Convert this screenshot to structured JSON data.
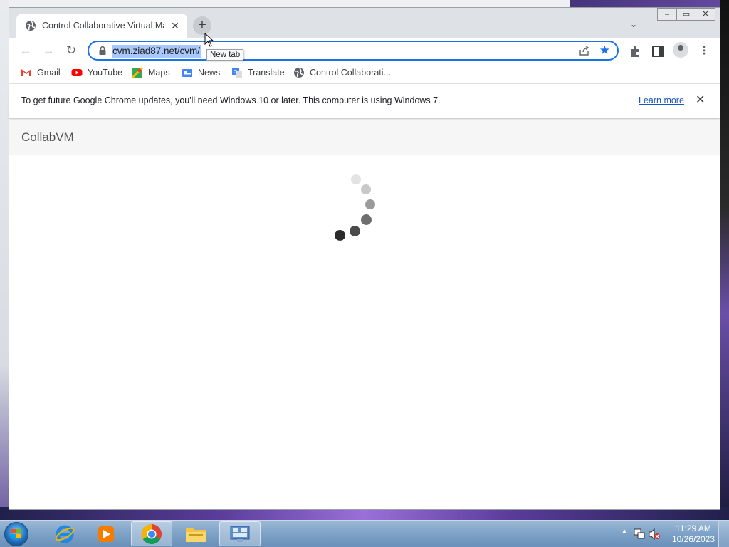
{
  "browser": {
    "tab": {
      "title": "Control Collaborative Virtual Machine",
      "close_glyph": "✕"
    },
    "new_tab_glyph": "+",
    "tab_search_glyph": "⌄",
    "window_controls": {
      "minimize": "–",
      "maximize": "▭",
      "close": "✕"
    },
    "tooltip": "New tab",
    "nav": {
      "back": "←",
      "forward": "→",
      "reload": "↻"
    },
    "omnibox": {
      "url": "cvm.ziad87.net/cvm/"
    },
    "bookmarks": [
      {
        "label": "Gmail",
        "icon": "gmail-icon"
      },
      {
        "label": "YouTube",
        "icon": "youtube-icon"
      },
      {
        "label": "Maps",
        "icon": "maps-icon"
      },
      {
        "label": "News",
        "icon": "news-icon"
      },
      {
        "label": "Translate",
        "icon": "translate-icon"
      },
      {
        "label": "Control Collaborati...",
        "icon": "globe-icon"
      }
    ],
    "infobar": {
      "message": "To get future Google Chrome updates, you'll need Windows 10 or later. This computer is using Windows 7.",
      "link": "Learn more",
      "close_glyph": "✕"
    }
  },
  "page": {
    "brand": "CollabVM",
    "state": "loading"
  },
  "taskbar": {
    "apps": [
      "internet-explorer-icon",
      "media-player-icon",
      "chrome-icon",
      "file-explorer-icon",
      "control-panel-icon"
    ],
    "active_app": "chrome-icon",
    "clock": {
      "time": "11:29 AM",
      "date": "10/26/2023"
    }
  },
  "colors": {
    "accent": "#1a73e8",
    "taskbar": "#7fa3c8",
    "link": "#1a57c5"
  }
}
